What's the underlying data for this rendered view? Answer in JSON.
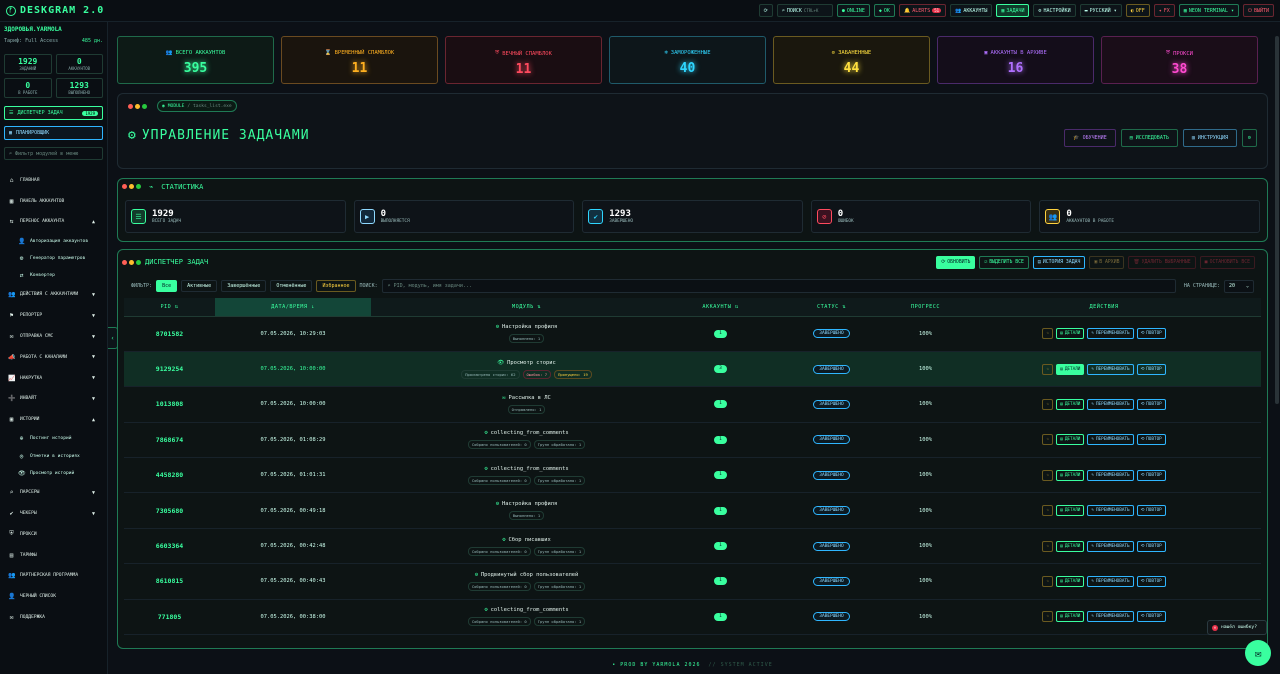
{
  "brand": {
    "name": "DESKGRAM 2.0",
    "logo": "ᚠ"
  },
  "topbar": [
    {
      "id": "refresh",
      "label": "⟳",
      "cls": ""
    },
    {
      "id": "search",
      "label": "ПОИСК",
      "kbd": "CTRL+K",
      "icon": "⌕",
      "cls": "search"
    },
    {
      "id": "online",
      "label": "ONLINE",
      "icon": "●",
      "cls": "green"
    },
    {
      "id": "ok",
      "label": "OK",
      "icon": "◆",
      "cls": "green"
    },
    {
      "id": "alerts",
      "label": "ALERTS",
      "count": "51",
      "icon": "🔔",
      "cls": "red"
    },
    {
      "id": "accounts",
      "label": "АККАУНТЫ",
      "icon": "👥",
      "cls": ""
    },
    {
      "id": "tasks",
      "label": "ЗАДАЧИ",
      "icon": "▦",
      "cls": "active"
    },
    {
      "id": "settings",
      "label": "НАСТРОЙКИ",
      "icon": "⚙",
      "cls": ""
    },
    {
      "id": "lang",
      "label": "РУССКИЙ ▾",
      "icon": "▬",
      "cls": ""
    },
    {
      "id": "off",
      "label": "OFF",
      "icon": "◐",
      "cls": "yellow"
    },
    {
      "id": "fx",
      "label": "FX",
      "icon": "✦",
      "cls": "red"
    },
    {
      "id": "neon",
      "label": "NEON TERMINAL ▾",
      "icon": "▦",
      "cls": "green"
    },
    {
      "id": "logout",
      "label": "ВЫЙТИ",
      "icon": "⏻",
      "cls": "red"
    }
  ],
  "sidebar": {
    "user": "ЗДОРОВЬЯ.YARMOLA",
    "tariff_label": "Тариф: Full Access",
    "tariff_days": "485 дн.",
    "stats": [
      {
        "value": "1929",
        "label": "ЗАДАНИЙ"
      },
      {
        "value": "0",
        "label": "АККАУНТОВ"
      },
      {
        "value": "0",
        "label": "В РАБОТЕ"
      },
      {
        "value": "1293",
        "label": "ВЫПОЛНЕНО"
      }
    ],
    "dispatcher_btn": "ДИСПЕТЧЕР ЗАДАЧ",
    "dispatcher_badge": "1929",
    "planner_btn": "ПЛАНИРОВЩИК",
    "filter_placeholder": "Фильтр модулей в меню",
    "nav": [
      {
        "label": "ГЛАВНАЯ",
        "icon": "⌂"
      },
      {
        "label": "ПАНЕЛЬ АККАУНТОВ",
        "icon": "▦"
      },
      {
        "label": "ПЕРЕНОС АККАУНТА",
        "icon": "⇆",
        "caret": "▲"
      },
      {
        "label": "Авторизация аккаунтов",
        "icon": "👤",
        "sub": true
      },
      {
        "label": "Генератор параметров",
        "icon": "⚙",
        "sub": true
      },
      {
        "label": "Конвертер",
        "icon": "⇄",
        "sub": true
      },
      {
        "label": "ДЕЙСТВИЯ С АККАУНТАМИ",
        "icon": "👥",
        "caret": "▼"
      },
      {
        "label": "РЕПОРТЕР",
        "icon": "⚑",
        "caret": "▼"
      },
      {
        "label": "ОТПРАВКА СМС",
        "icon": "✉",
        "caret": "▼"
      },
      {
        "label": "РАБОТА С КАНАЛАМИ",
        "icon": "📣",
        "caret": "▼"
      },
      {
        "label": "НАКРУТКА",
        "icon": "📈",
        "caret": "▼"
      },
      {
        "label": "ИНВАЙТ",
        "icon": "➕",
        "caret": "▼"
      },
      {
        "label": "ИСТОРИИ",
        "icon": "▣",
        "caret": "▲"
      },
      {
        "label": "Постинг историй",
        "icon": "⊕",
        "sub": true
      },
      {
        "label": "Отметки в историях",
        "icon": "◎",
        "sub": true
      },
      {
        "label": "Просмотр историй",
        "icon": "👁",
        "sub": true
      },
      {
        "label": "ПАРСЕРЫ",
        "icon": "⌕",
        "caret": "▼"
      },
      {
        "label": "ЧЕКЕРЫ",
        "icon": "✔",
        "caret": "▼"
      },
      {
        "label": "ПРОКСИ",
        "icon": "⛨"
      },
      {
        "label": "ТАРИФЫ",
        "icon": "▤"
      },
      {
        "label": "ПАРТНЕРСКАЯ ПРОГРАММА",
        "icon": "👥"
      },
      {
        "label": "ЧЕРНЫЙ СПИСОК",
        "icon": "👤"
      },
      {
        "label": "ПОДДЕРЖКА",
        "icon": "✉"
      }
    ]
  },
  "summary": [
    {
      "label": "ВСЕГО АККАУНТОВ",
      "value": "395",
      "color": "#39ff9f",
      "border": "#1f6a4a",
      "bg": "#0d1a16",
      "icon": "👥"
    },
    {
      "label": "ВРЕМЕННЫЙ СПАМБЛОК",
      "value": "11",
      "color": "#ffb020",
      "border": "#6a4a20",
      "bg": "#1a140d",
      "icon": "⌛"
    },
    {
      "label": "ВЕЧНЫЙ СПАМБЛОК",
      "value": "11",
      "color": "#ff4a5e",
      "border": "#6a2530",
      "bg": "#1a0d12",
      "icon": "⛨"
    },
    {
      "label": "ЗАМОРОЖЕННЫЕ",
      "value": "40",
      "color": "#2fd6ff",
      "border": "#1f5a6a",
      "bg": "#0d161a",
      "icon": "❄"
    },
    {
      "label": "ЗАБАНЕННЫЕ",
      "value": "44",
      "color": "#ffe03f",
      "border": "#6a5a20",
      "bg": "#1a170d",
      "icon": "⊘"
    },
    {
      "label": "АККАУНТЫ В АРХИВЕ",
      "value": "16",
      "color": "#b070ff",
      "border": "#4a2a6a",
      "bg": "#140d1a",
      "icon": "▣"
    },
    {
      "label": "ПРОКСИ",
      "value": "38",
      "color": "#ff4ad0",
      "border": "#5a2050",
      "bg": "#1a0d18",
      "icon": "⛨"
    }
  ],
  "module": {
    "tag": "MODULE",
    "path": "tasks_list.exe",
    "title": "УПРАВЛЕНИЕ ЗАДАЧАМИ",
    "buttons": [
      {
        "label": "ОБУЧЕНИЕ",
        "icon": "🎓",
        "color": "#c080ff",
        "border": "#4a2a6a"
      },
      {
        "label": "ИССЛЕДОВАТЬ",
        "icon": "▤",
        "color": "#39ff9f",
        "border": "#1f6a4a"
      },
      {
        "label": "ИНСТРУКЦИЯ",
        "icon": "▥",
        "color": "#8fd9ff",
        "border": "#2f6a8a"
      }
    ]
  },
  "stats": {
    "title": "СТАТИСТИКА",
    "items": [
      {
        "value": "1929",
        "label": "ВСЕГО ЗАДАЧ",
        "icon": "☰",
        "color": "#39ff9f",
        "bg": "#123a2a"
      },
      {
        "value": "0",
        "label": "ВЫПОЛНЯЕТСЯ",
        "icon": "▶",
        "color": "#8fd9ff",
        "bg": "#12283a"
      },
      {
        "value": "1293",
        "label": "ЗАВЕРШЕНО",
        "icon": "✔",
        "color": "#2fd6ff",
        "bg": "#123040"
      },
      {
        "value": "0",
        "label": "ОШИБОК",
        "icon": "⊘",
        "color": "#ff4a5e",
        "bg": "#3a1220"
      },
      {
        "value": "0",
        "label": "АККАУНТОВ В РАБОТЕ",
        "icon": "👥",
        "color": "#ffd23f",
        "bg": "#3a3012"
      }
    ]
  },
  "dispatcher": {
    "title": "ДИСПЕТЧЕР ЗАДАЧ",
    "buttons": [
      {
        "label": "ОБНОВИТЬ",
        "icon": "⟳",
        "cls": "primary"
      },
      {
        "label": "ВЫДЕЛИТЬ ВСЕ",
        "icon": "☑",
        "cls": "g"
      },
      {
        "label": "ИСТОРИЯ ЗАДАЧ",
        "icon": "▤",
        "cls": "b"
      },
      {
        "label": "В АРХИВ",
        "icon": "▣",
        "cls": "dis"
      },
      {
        "label": "УДАЛИТЬ ВЫБРАННЫЕ",
        "icon": "🗑",
        "cls": "dis2"
      },
      {
        "label": "ОСТАНОВИТЬ ВСЕ",
        "icon": "■",
        "cls": "dis2"
      }
    ],
    "filter_label": "ФИЛЬТР:",
    "filters": [
      {
        "label": "Все",
        "cls": "on"
      },
      {
        "label": "Активные",
        "cls": ""
      },
      {
        "label": "Завершённые",
        "cls": ""
      },
      {
        "label": "Отменённые",
        "cls": ""
      },
      {
        "label": "Избранное",
        "cls": "star"
      }
    ],
    "search_label": "ПОИСК:",
    "search_placeholder": "PID, модуль, имя задачи...",
    "per_page_label": "НА СТРАНИЦЕ:",
    "per_page": "20",
    "columns": [
      "PID ⇅",
      "ДАТА/ВРЕМЯ ↓",
      "МОДУЛЬ ⇅",
      "АККАУНТЫ ⇅",
      "СТАТУС ⇅",
      "ПРОГРЕСС",
      "ДЕЙСТВИЯ"
    ],
    "actions": {
      "details": "ДЕТАЛИ",
      "rename": "ПЕРЕИМЕНОВАТЬ",
      "repeat": "ПОВТОР"
    },
    "rows": [
      {
        "pid": "8701582",
        "datetime": "07.05.2026, 10:29:03",
        "module": "Настройка профиля",
        "icon": "⚙",
        "tags": [
          {
            "t": "Выполнено: 1"
          }
        ],
        "accounts": "1",
        "status": "ЗАВЕРШЕНО",
        "progress": "100%"
      },
      {
        "pid": "9129254",
        "datetime": "07.05.2026, 10:00:00",
        "module": "Просмотр сторис",
        "icon": "👁",
        "tags": [
          {
            "t": "Просмотрено сторис: 62"
          },
          {
            "t": "Ошибок: 7",
            "c": "r"
          },
          {
            "t": "Пропущено: 19",
            "c": "y"
          }
        ],
        "accounts": "3",
        "status": "ЗАВЕРШЕНО",
        "progress": "100%",
        "hl": true
      },
      {
        "pid": "1013808",
        "datetime": "07.05.2026, 10:00:00",
        "module": "Рассылка в ЛС",
        "icon": "✉",
        "tags": [
          {
            "t": "Отправлено: 1"
          }
        ],
        "accounts": "1",
        "status": "ЗАВЕРШЕНО",
        "progress": "100%"
      },
      {
        "pid": "7868674",
        "datetime": "07.05.2026, 01:08:29",
        "module": "collecting_from_comments",
        "icon": "⚙",
        "tags": [
          {
            "t": "Собрано пользователей: 0"
          },
          {
            "t": "Групп обработано: 1"
          }
        ],
        "accounts": "1",
        "status": "ЗАВЕРШЕНО",
        "progress": "100%"
      },
      {
        "pid": "4458280",
        "datetime": "07.05.2026, 01:01:31",
        "module": "collecting_from_comments",
        "icon": "⚙",
        "tags": [
          {
            "t": "Собрано пользователей: 0"
          },
          {
            "t": "Групп обработано: 1"
          }
        ],
        "accounts": "1",
        "status": "ЗАВЕРШЕНО",
        "progress": "100%"
      },
      {
        "pid": "7305680",
        "datetime": "07.05.2026, 00:49:18",
        "module": "Настройка профиля",
        "icon": "⚙",
        "tags": [
          {
            "t": "Выполнено: 1"
          }
        ],
        "accounts": "1",
        "status": "ЗАВЕРШЕНО",
        "progress": "100%"
      },
      {
        "pid": "6603364",
        "datetime": "07.05.2026, 00:42:48",
        "module": "Сбор писавших",
        "icon": "⚙",
        "tags": [
          {
            "t": "Собрано пользователей: 0"
          },
          {
            "t": "Групп обработано: 1"
          }
        ],
        "accounts": "1",
        "status": "ЗАВЕРШЕНО",
        "progress": "100%"
      },
      {
        "pid": "8610815",
        "datetime": "07.05.2026, 00:40:43",
        "module": "Продвинутый сбор пользователей",
        "icon": "⚙",
        "tags": [
          {
            "t": "Собрано пользователей: 0"
          },
          {
            "t": "Групп обработано: 1"
          }
        ],
        "accounts": "1",
        "status": "ЗАВЕРШЕНО",
        "progress": "100%"
      },
      {
        "pid": "771805",
        "datetime": "07.05.2026, 00:38:00",
        "module": "collecting_from_comments",
        "icon": "⚙",
        "tags": [
          {
            "t": "Собрано пользователей: 0"
          },
          {
            "t": "Групп обработано: 1"
          }
        ],
        "accounts": "1",
        "status": "ЗАВЕРШЕНО",
        "progress": "100%"
      }
    ]
  },
  "footer": {
    "text": "• PROD BY YARMOLA 2026",
    "dim": "// SYSTEM ACTIVE"
  },
  "error_popup": "нашёл ошибку?",
  "chat_icon": "✉"
}
